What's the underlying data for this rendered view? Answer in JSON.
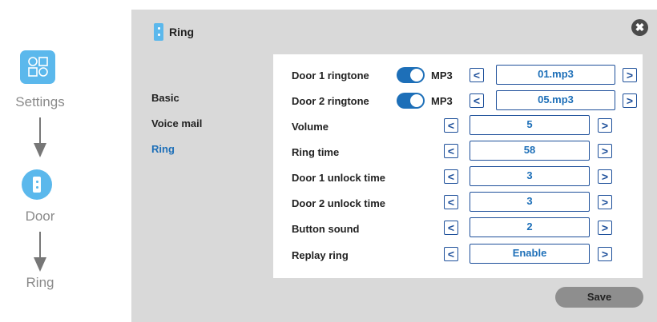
{
  "flow": {
    "steps": [
      "Settings",
      "Door",
      "Ring"
    ]
  },
  "header": {
    "title": "Ring"
  },
  "menu": {
    "items": [
      {
        "label": "Basic",
        "active": false
      },
      {
        "label": "Voice mail",
        "active": false
      },
      {
        "label": "Ring",
        "active": true
      }
    ]
  },
  "settings": [
    {
      "label": "Door 1 ringtone",
      "toggle": true,
      "format": "MP3",
      "value": "01.mp3"
    },
    {
      "label": "Door 2 ringtone",
      "toggle": true,
      "format": "MP3",
      "value": "05.mp3"
    },
    {
      "label": "Volume",
      "value": "5"
    },
    {
      "label": "Ring time",
      "value": "58"
    },
    {
      "label": "Door 1 unlock time",
      "value": "3"
    },
    {
      "label": "Door 2 unlock time",
      "value": "3"
    },
    {
      "label": "Button sound",
      "value": "2"
    },
    {
      "label": "Replay ring",
      "value": "Enable"
    }
  ],
  "buttons": {
    "prev": "<",
    "next": ">",
    "save": "Save",
    "close": "✖"
  },
  "colors": {
    "accent": "#5bb8ec",
    "active_text": "#1d6fb8",
    "panel_bg": "#d9d9d9"
  }
}
